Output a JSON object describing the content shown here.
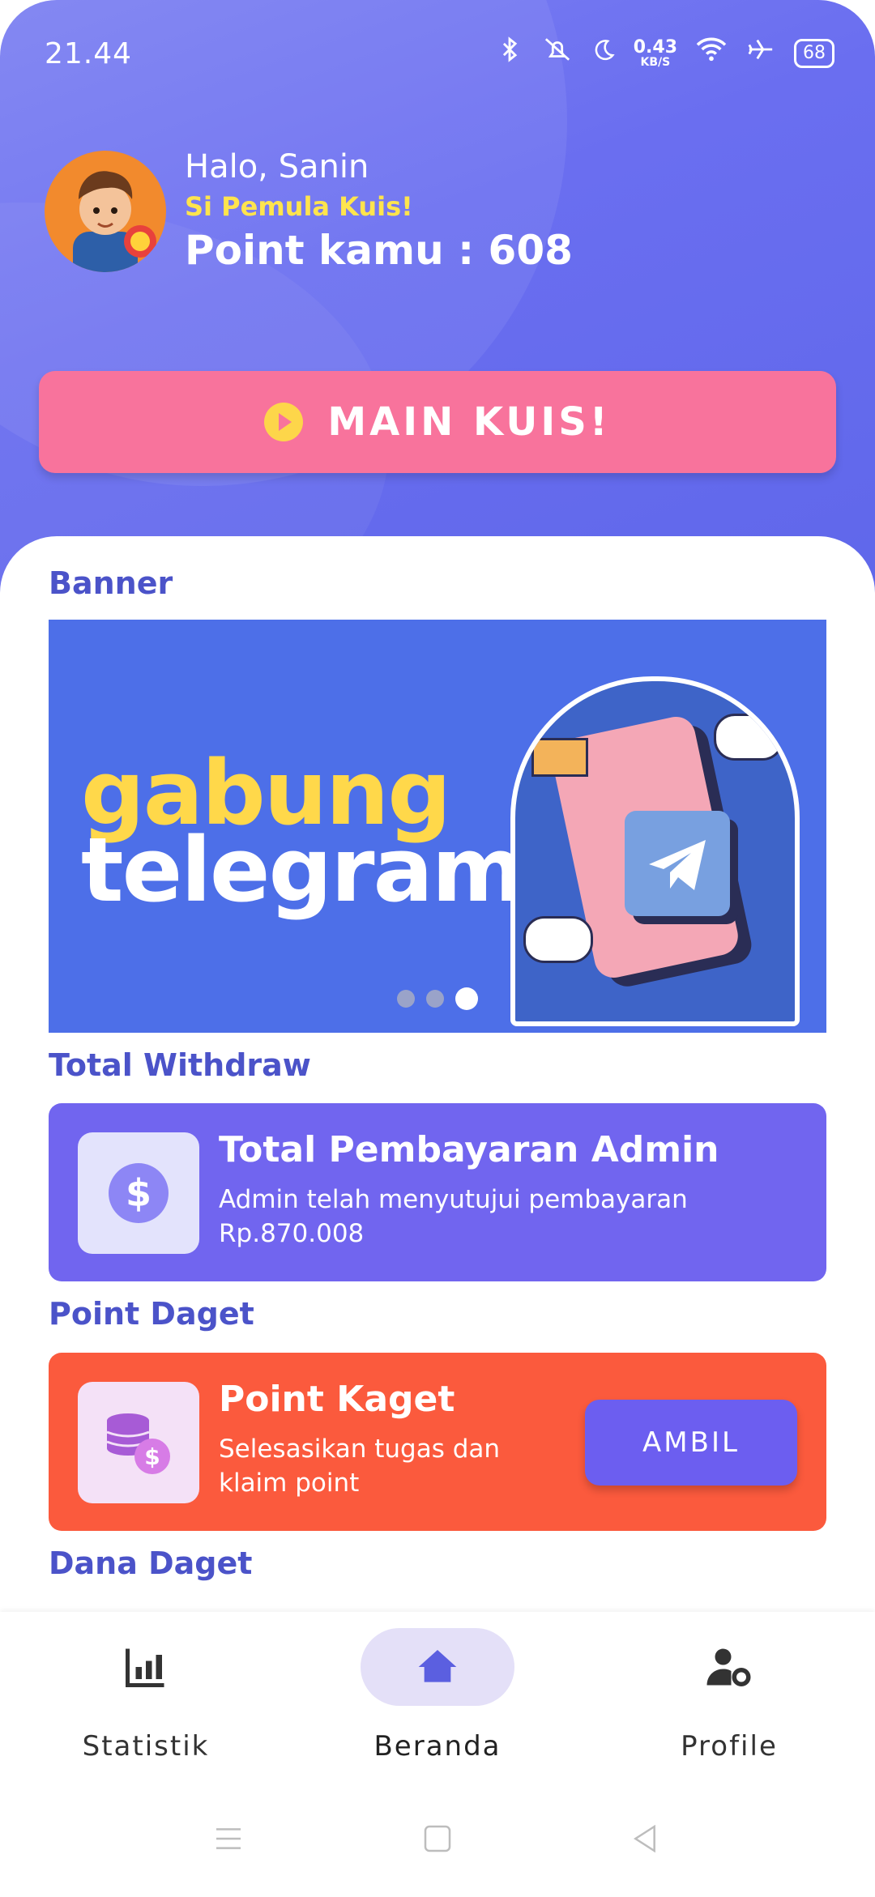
{
  "status_bar": {
    "time": "21.44",
    "net_speed_value": "0.43",
    "net_speed_unit": "KB/S",
    "battery": "68"
  },
  "header": {
    "greeting": "Halo, Sanin",
    "level": "Si Pemula Kuis!",
    "points": "Point kamu : 608"
  },
  "play_button": {
    "label": "MAIN KUIS!"
  },
  "banner": {
    "section_title": "Banner",
    "headline_line1": "gabung",
    "headline_line2": "telegram!",
    "slide_count": 3,
    "active_slide": 3
  },
  "withdraw": {
    "section_title": "Total Withdraw",
    "title": "Total Pembayaran Admin",
    "subtitle": "Admin telah menyutujui pembayaran Rp.870.008",
    "icon": "dollar-icon"
  },
  "point_daget": {
    "section_title": "Point Daget",
    "title": "Point Kaget",
    "subtitle": "Selesasikan tugas dan klaim point",
    "button": "AMBIL",
    "icon": "coins-icon"
  },
  "dana_daget": {
    "section_title": "Dana Daget"
  },
  "bottom_nav": {
    "items": [
      {
        "label": "Statistik",
        "icon": "chart-icon"
      },
      {
        "label": "Beranda",
        "icon": "home-icon",
        "active": true
      },
      {
        "label": "Profile",
        "icon": "user-settings-icon"
      }
    ]
  },
  "colors": {
    "hero": "#6a6ef0",
    "play_button": "#f8739c",
    "withdraw_card": "#7165ef",
    "point_card": "#fb5a3d",
    "section_title": "#4b53c9"
  }
}
